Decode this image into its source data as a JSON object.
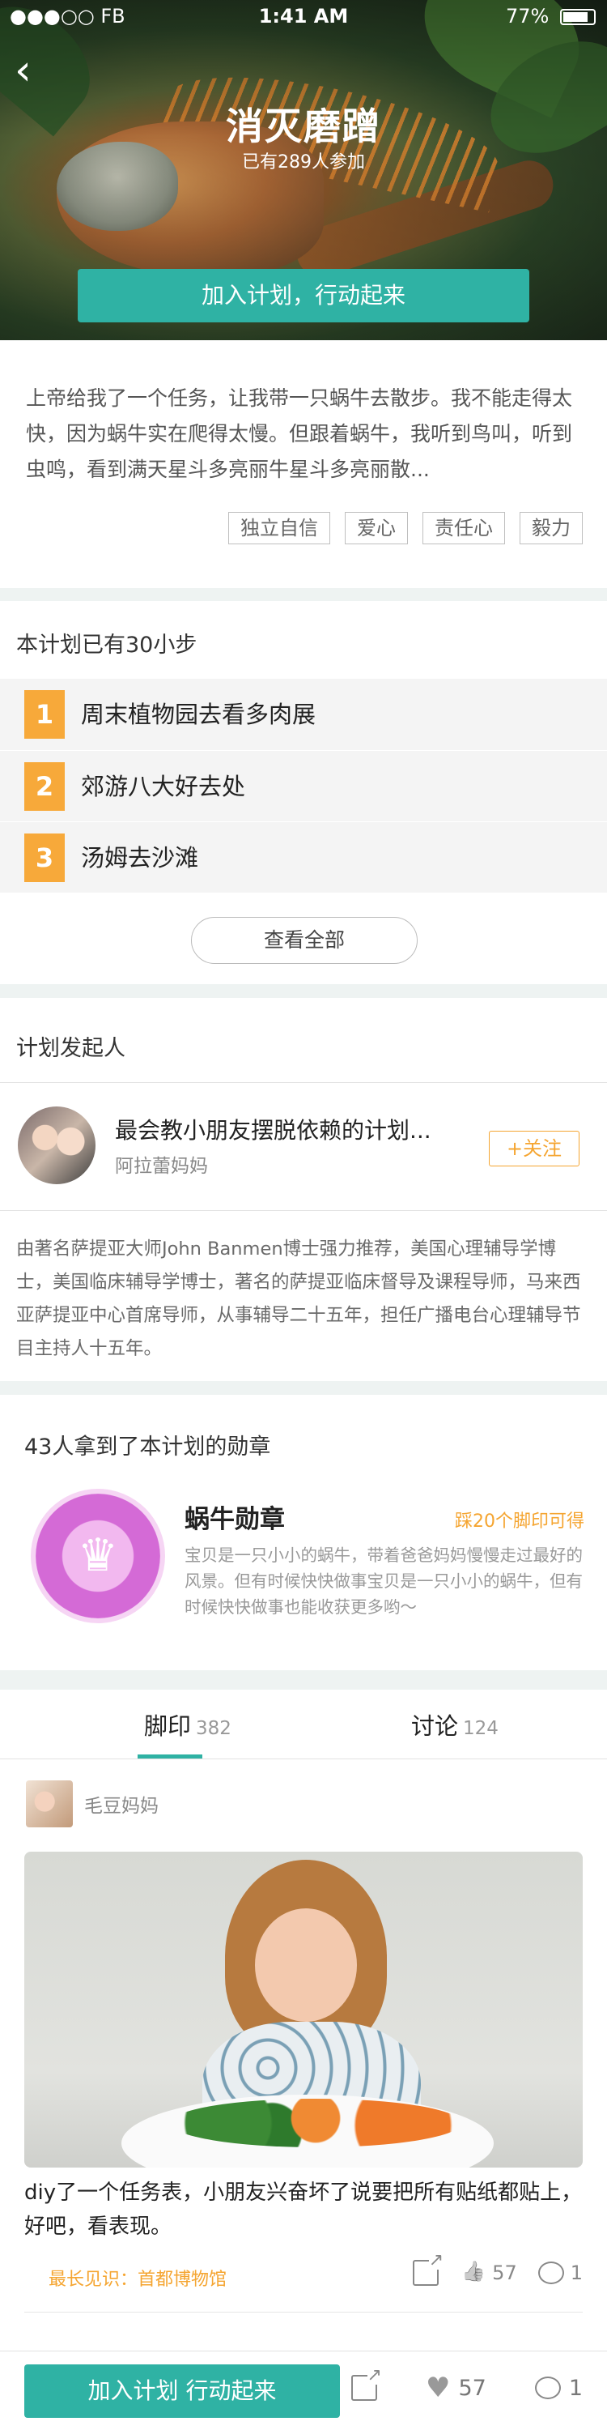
{
  "statusbar": {
    "left": "●●●○○ FB",
    "time": "1:41 AM",
    "battery": "77%"
  },
  "hero": {
    "back_icon": "chevron-left-icon",
    "title": "消灭磨蹭",
    "participants": "已有289人参加",
    "join_label": "加入计划，行动起来"
  },
  "intro": {
    "text": "上帝给我了一个任务，让我带一只蜗牛去散步。我不能走得太快，因为蜗牛实在爬得太慢。但跟着蜗牛，我听到鸟叫，听到虫鸣，看到满天星斗多亮丽牛星斗多亮丽散...",
    "tags": [
      "独立自信",
      "爱心",
      "责任心",
      "毅力"
    ]
  },
  "steps": {
    "heading": "本计划已有30小步",
    "items": [
      {
        "num": "1",
        "label": "周末植物园去看多肉展"
      },
      {
        "num": "2",
        "label": "郊游八大好去处"
      },
      {
        "num": "3",
        "label": "汤姆去沙滩"
      }
    ],
    "view_all": "查看全部"
  },
  "founder": {
    "heading": "计划发起人",
    "name": "最会教小朋友摆脱依赖的计划...",
    "sub": "阿拉蕾妈妈",
    "follow": "+关注",
    "bio": "由著名萨提亚大师John Banmen博士强力推荐，美国心理辅导学博士，美国临床辅导学博士，著名的萨提亚临床督导及课程导师，马来西亚萨提亚中心首席导师，从事辅导二十五年，担任广播电台心理辅导节目主持人十五年。"
  },
  "badge": {
    "heading": "43人拿到了本计划的勋章",
    "name": "蜗牛勋章",
    "condition": "踩20个脚印可得",
    "desc": "宝贝是一只小小的蜗牛，带着爸爸妈妈慢慢走过最好的风景。但有时候快快做事宝贝是一只小小的蜗牛，但有时候快快做事也能收获更多哟～",
    "icon": "crown-icon"
  },
  "feed": {
    "tabs": [
      {
        "label": "脚印",
        "count": "382"
      },
      {
        "label": "讨论",
        "count": "124"
      }
    ],
    "post": {
      "author": "毛豆妈妈",
      "text": "diy了一个任务表，小朋友兴奋坏了说要把所有贴纸都贴上，好吧，看表现。",
      "meta": "最长见识：首都博物馆",
      "likes": "57",
      "comments": "1"
    }
  },
  "bottom": {
    "join_label": "加入计划 行动起来",
    "likes": "57",
    "comments": "1"
  },
  "colors": {
    "accent": "#2fb2a4",
    "orange": "#f5a531",
    "step_num": "#f7a93a"
  }
}
